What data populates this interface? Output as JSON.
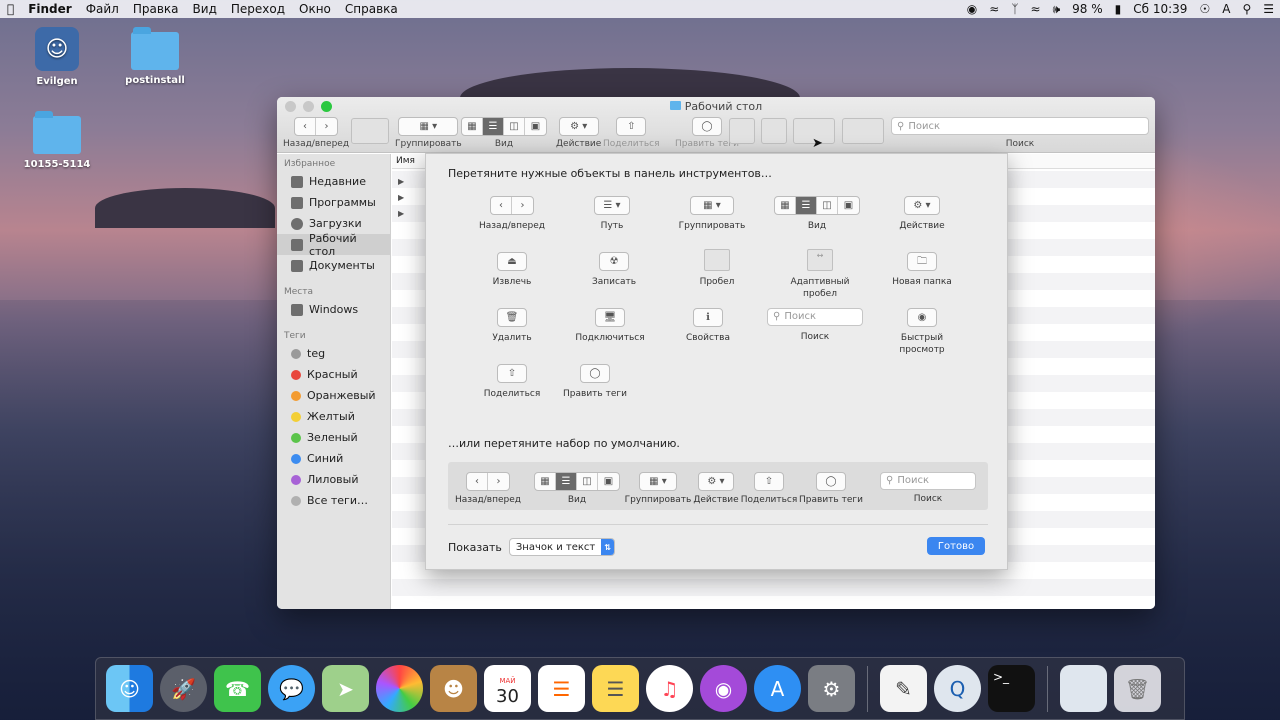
{
  "menubar": {
    "app": "Finder",
    "items": [
      "Файл",
      "Правка",
      "Вид",
      "Переход",
      "Окно",
      "Справка"
    ],
    "battery": "98 %",
    "clock": "Сб 10:39",
    "input_lang": "A"
  },
  "desktop": {
    "icons": [
      "Evilgen",
      "postinstall",
      "10155-5114"
    ]
  },
  "window": {
    "title": "Рабочий стол",
    "toolbar": {
      "back_forward": "Назад/вперед",
      "group": "Группировать",
      "view": "Вид",
      "action": "Действие",
      "share": "Поделиться",
      "tags": "Править теги",
      "search": "Поиск",
      "search_placeholder": "Поиск"
    },
    "sidebar": {
      "favorites_header": "Избранное",
      "favorites": [
        "Недавние",
        "Программы",
        "Загрузки",
        "Рабочий стол",
        "Документы"
      ],
      "places_header": "Места",
      "places": [
        "Windows"
      ],
      "tags_header": "Теги",
      "tags": [
        {
          "label": "teg",
          "color": "#9a9a9a"
        },
        {
          "label": "Красный",
          "color": "#e8463c"
        },
        {
          "label": "Оранжевый",
          "color": "#f39b30"
        },
        {
          "label": "Желтый",
          "color": "#f3cf35"
        },
        {
          "label": "Зеленый",
          "color": "#5bc44a"
        },
        {
          "label": "Синий",
          "color": "#3c8cf0"
        },
        {
          "label": "Лиловый",
          "color": "#a762d6"
        },
        {
          "label": "Все теги…",
          "color": "#b0b0b0"
        }
      ]
    },
    "column_header": "Имя"
  },
  "sheet": {
    "instruction": "Перетяните нужные объекты в панель инструментов…",
    "items": {
      "back_forward": "Назад/вперед",
      "path": "Путь",
      "group": "Группировать",
      "view": "Вид",
      "action": "Действие",
      "eject": "Извлечь",
      "burn": "Записать",
      "space": "Пробел",
      "flex_space_1": "Адаптивный",
      "flex_space_2": "пробел",
      "new_folder": "Новая папка",
      "delete": "Удалить",
      "connect": "Подключиться",
      "info": "Свойства",
      "search": "Поиск",
      "search_placeholder": "Поиск",
      "quicklook_1": "Быстрый",
      "quicklook_2": "просмотр",
      "share": "Поделиться",
      "tags": "Править теги"
    },
    "default_title": "…или перетяните набор по умолчанию.",
    "default": {
      "back_forward": "Назад/вперед",
      "view": "Вид",
      "group": "Группировать",
      "action": "Действие",
      "share": "Поделиться",
      "tags": "Править теги",
      "search": "Поиск",
      "search_placeholder": "Поиск"
    },
    "show_label": "Показать",
    "show_value": "Значок и текст",
    "done": "Готово"
  },
  "dock": {
    "items": [
      "Finder",
      "Launchpad",
      "FaceTime",
      "Сообщения",
      "Карты",
      "Фото",
      "Контакты",
      "Календарь",
      "Напоминания",
      "Заметки",
      "Музыка",
      "Подкасты",
      "App Store",
      "Системные настройки",
      "TextEdit",
      "QuickTime Player",
      "Терминал",
      "Загрузки",
      "Корзина"
    ],
    "calendar_month": "МАЙ",
    "calendar_day": "30"
  }
}
